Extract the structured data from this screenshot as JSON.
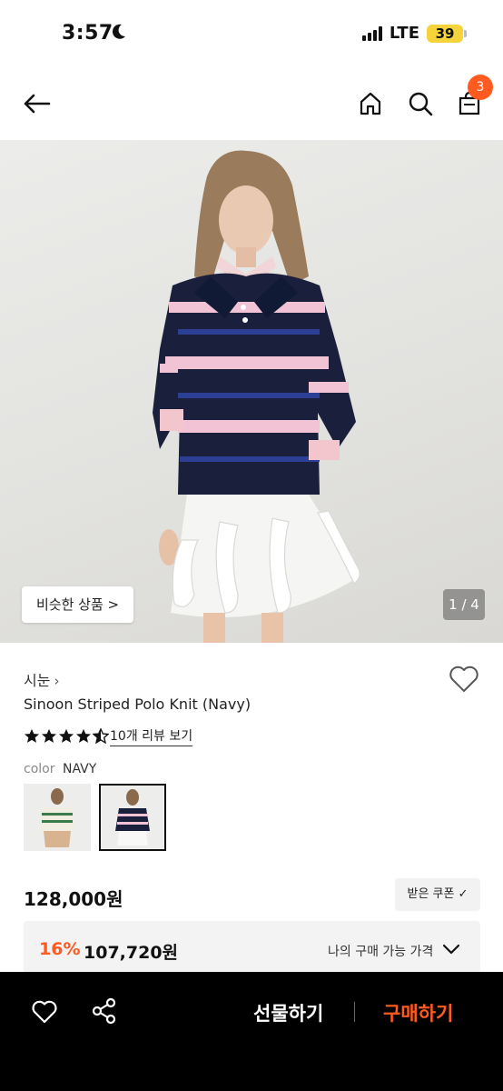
{
  "status_bar": {
    "time": "3:57",
    "network": "LTE",
    "battery": "39"
  },
  "header": {
    "cart_count": "3"
  },
  "gallery": {
    "similar_label": "비슷한 상품 >",
    "counter": "1 / 4"
  },
  "product": {
    "brand": "시눈",
    "name": "Sinoon Striped Polo Knit (Navy)",
    "rating": 4.5,
    "review_link": "10개 리뷰 보기",
    "color_label": "color",
    "color_value": "NAVY",
    "price": "128,000원",
    "coupon_label": "받은 쿠폰",
    "discount_rate": "16%",
    "discount_price": "107,720원",
    "my_price_label": "나의 구매 가능 가격"
  },
  "bottom_bar": {
    "gift_label": "선물하기",
    "buy_label": "구매하기"
  },
  "colors": {
    "accent": "#ff5a1f",
    "bar_bg": "#000000"
  }
}
